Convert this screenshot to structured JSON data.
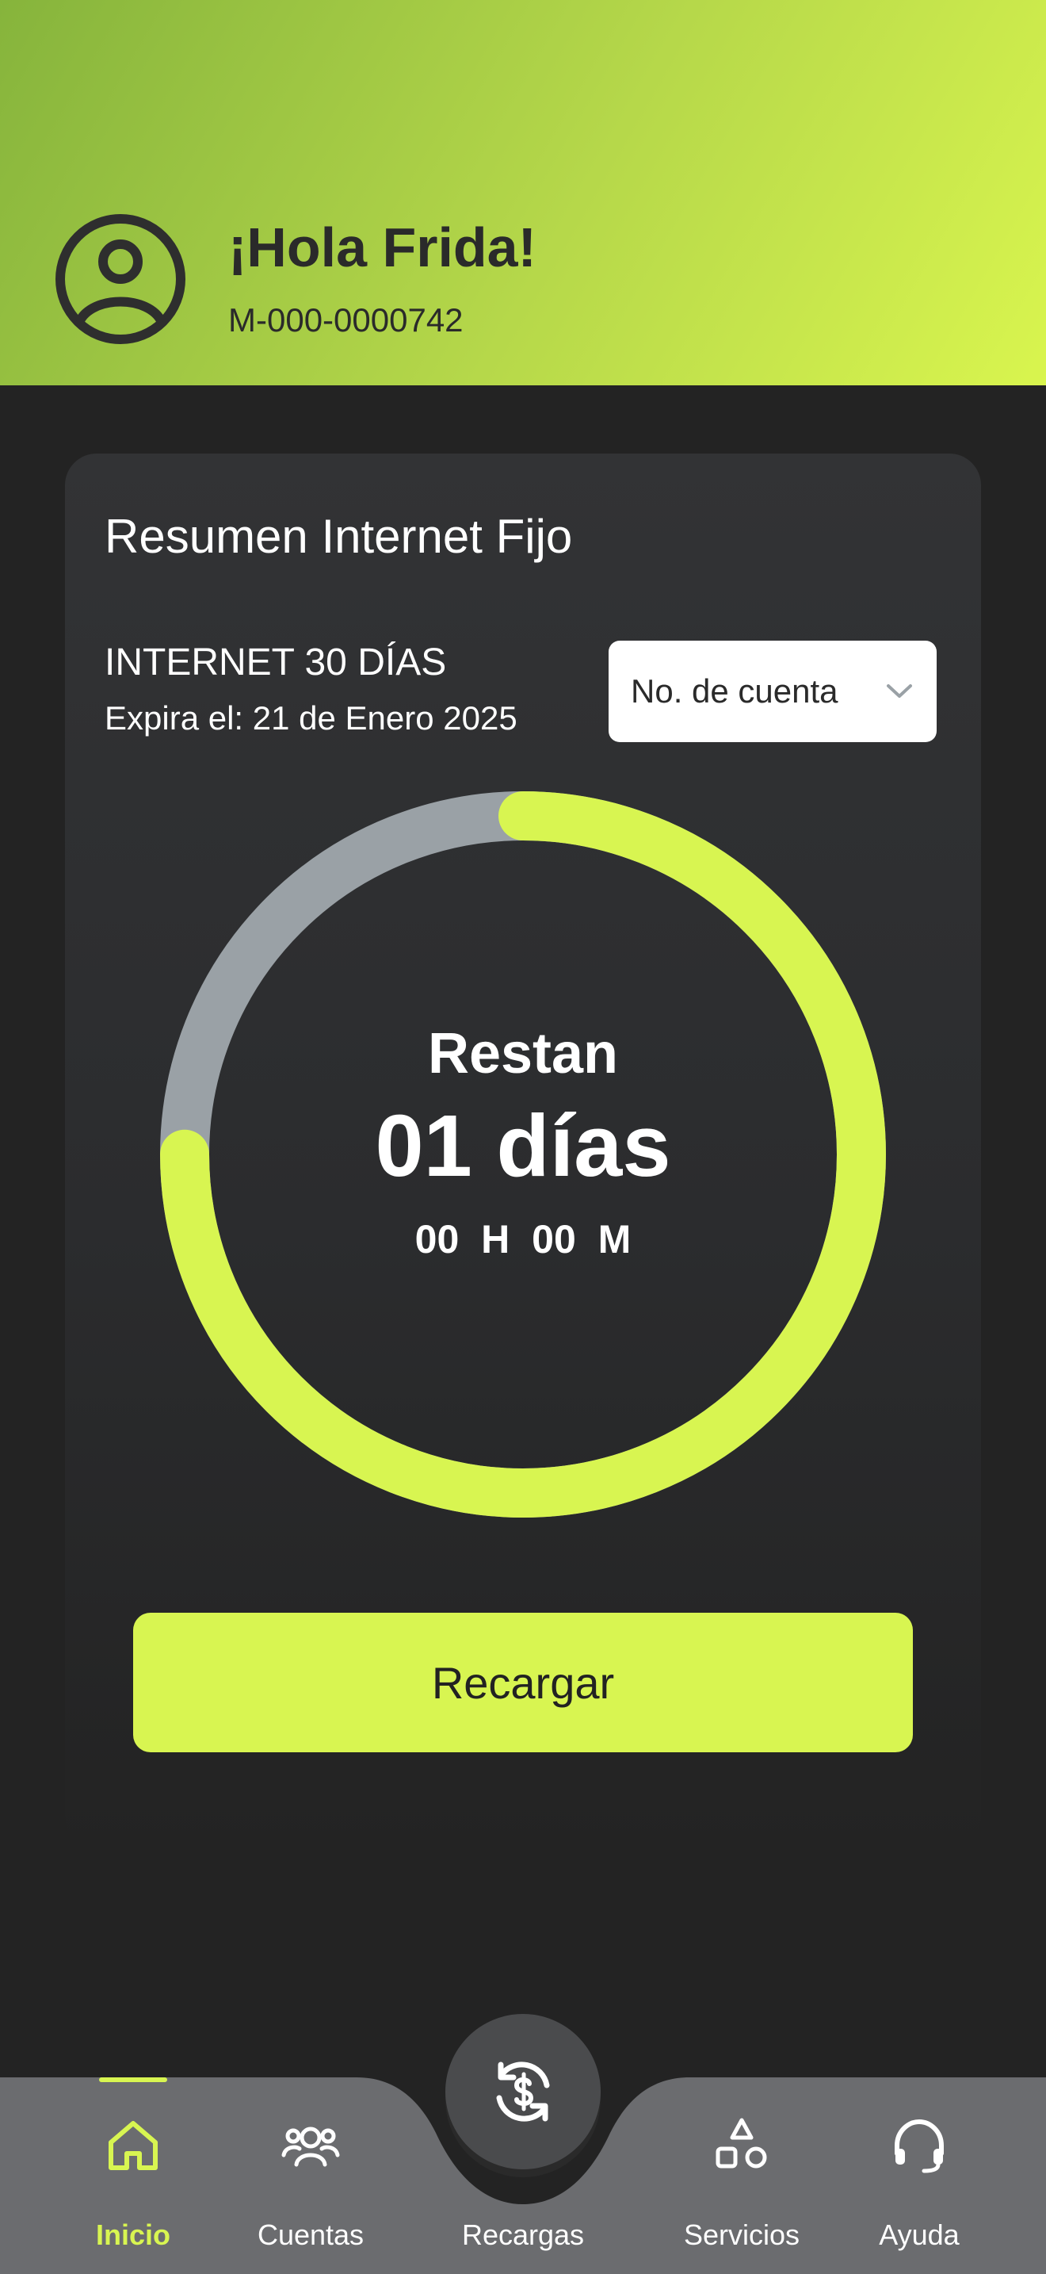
{
  "header": {
    "greeting": "¡Hola Frida!",
    "account_id": "M-000-0000742",
    "icon": "user-circle-icon"
  },
  "summary": {
    "title": "Resumen Internet Fijo",
    "plan_name": "INTERNET 30 DÍAS",
    "expiry": "Expira el: 21 de Enero 2025",
    "account_select": {
      "value": "No. de cuenta",
      "icon": "chevron-down-icon"
    },
    "timer": {
      "label": "Restan",
      "days": "01 días",
      "hours_minutes": "00 H 00 M",
      "remaining_fraction": 0.75
    },
    "recharge_label": "Recargar"
  },
  "colors": {
    "accent": "#d8f551",
    "ring_track": "#9aa1a6",
    "background": "#232323",
    "card": "#323335",
    "nav": "#6b6c6f"
  },
  "nav": {
    "items": [
      {
        "label": "Inicio",
        "icon": "home-icon",
        "active": true
      },
      {
        "label": "Cuentas",
        "icon": "users-icon",
        "active": false
      },
      {
        "label": "Recargas",
        "icon": "dollar-refresh-icon",
        "active": false
      },
      {
        "label": "Servicios",
        "icon": "shapes-icon",
        "active": false
      },
      {
        "label": "Ayuda",
        "icon": "headset-icon",
        "active": false
      }
    ]
  }
}
